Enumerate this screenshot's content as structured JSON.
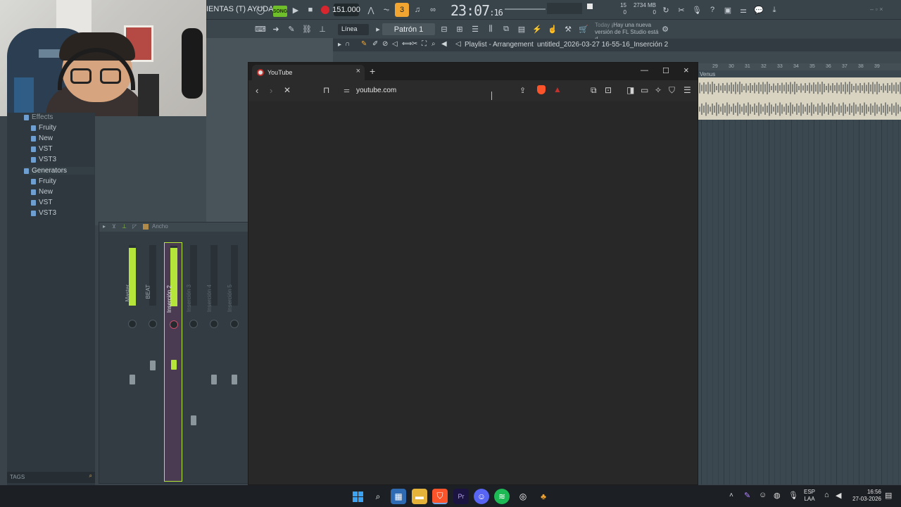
{
  "fl": {
    "menu_text": "IENTAS (T)  AYUDA",
    "song_label": "SONG",
    "bpm": "151.000",
    "clock_main": "23:07",
    "clock_sub": ":16",
    "voices_top": "15",
    "voices_bottom": "0",
    "mem_top": "2734 MB",
    "mem_bottom": "0",
    "snap": "Línea",
    "pattern": "Patrón 1",
    "news_today": "Today",
    "news_text": "¡Hay una nueva versión de FL Studio está d...",
    "playlist_title": "Playlist - Arrangement",
    "playlist_file": "untitled_2026-03-27 16-55-16_Inserción 2"
  },
  "browser_tree": {
    "effects": "Effects",
    "effects_items": [
      "Fruity",
      "New",
      "VST",
      "VST3"
    ],
    "generators": "Generators",
    "generators_items": [
      "Fruity",
      "New",
      "VST",
      "VST3"
    ],
    "tags": "TAGS"
  },
  "mixer": {
    "width_label": "Ancho",
    "tracks": [
      {
        "name": "Master",
        "level": 0.95
      },
      {
        "name": "BEAT",
        "level": 0.0
      },
      {
        "name": "Inserción 2",
        "level": 0.97
      },
      {
        "name": "Inserción 3",
        "level": 0.0
      },
      {
        "name": "Inserción 4",
        "level": 0.0
      },
      {
        "name": "Inserción 5",
        "level": 0.0
      }
    ]
  },
  "playlist_right": {
    "ruler": [
      "29",
      "30",
      "31",
      "32",
      "33",
      "34",
      "35",
      "36",
      "37",
      "38",
      "39"
    ],
    "track": "Venus"
  },
  "browser": {
    "tab_title": "YouTube",
    "url": "youtube.com",
    "accent": "#c4302b"
  },
  "taskbar": {
    "lang_top": "ESP",
    "lang_bottom": "LAA",
    "time": "16:56",
    "date": "27-03-2026"
  }
}
